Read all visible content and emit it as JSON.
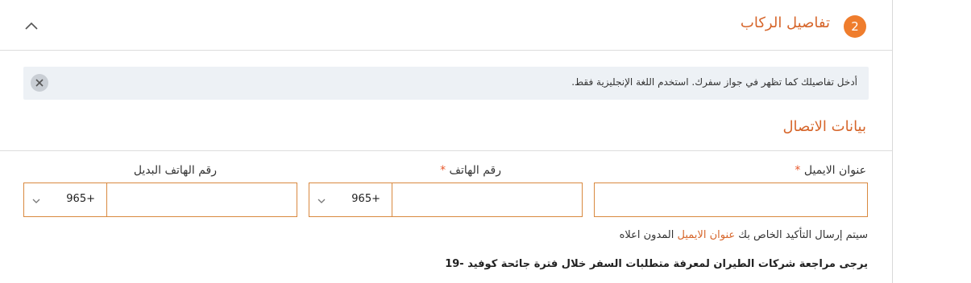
{
  "passenger_section": {
    "step_number": "2",
    "title": "تفاصيل الركاب"
  },
  "notice": {
    "text": "أدخل تفاصيلك كما تظهر في جواز سفرك. استخدم اللغة الإنجليزية فقط."
  },
  "contact": {
    "title": "بيانات الاتصال",
    "email_label": "عنوان الايميل",
    "phone_label": "رقم الهاتف",
    "alt_phone_label": "رقم الهاتف البديل",
    "required_mark": "*",
    "phone_code": "965+",
    "alt_phone_code": "965+",
    "email_value": "",
    "phone_value": "",
    "alt_phone_value": ""
  },
  "confirmation": {
    "prefix": "سيتم إرسال التأكيد الخاص بك",
    "link": "عنوان الايميل",
    "suffix": "المدون اعلاه"
  },
  "covid_note": "يرجى مراجعة شركات الطيران لمعرفة متطلبات السفر خلال فترة جائحة كوفيد -19",
  "colors": {
    "accent": "#d6652a",
    "step_circle": "#ef7d2d",
    "input_border": "#d9893f",
    "notice_bg": "#edf1f5"
  }
}
